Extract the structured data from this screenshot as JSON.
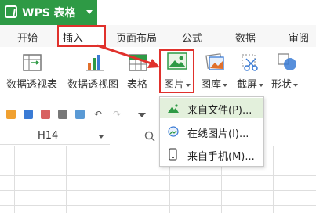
{
  "app": {
    "title": "WPS 表格"
  },
  "tabs": [
    {
      "label": "开始"
    },
    {
      "label": "插入"
    },
    {
      "label": "页面布局"
    },
    {
      "label": "公式"
    },
    {
      "label": "数据"
    },
    {
      "label": "审阅"
    }
  ],
  "ribbon": {
    "pivot_table": "数据透视表",
    "pivot_chart": "数据透视图",
    "table": "表格",
    "picture": "图片",
    "gallery": "图库",
    "screenshot": "截屏",
    "shapes": "形状"
  },
  "name_box": {
    "value": "H14"
  },
  "picture_menu": {
    "items": [
      {
        "label": "来自文件(P)..."
      },
      {
        "label": "在线图片(I)..."
      },
      {
        "label": "来自手机(M)..."
      }
    ]
  },
  "colors": {
    "brand": "#2e9a45",
    "highlight": "#e0312c",
    "menu_hover": "#e3f0dc"
  }
}
